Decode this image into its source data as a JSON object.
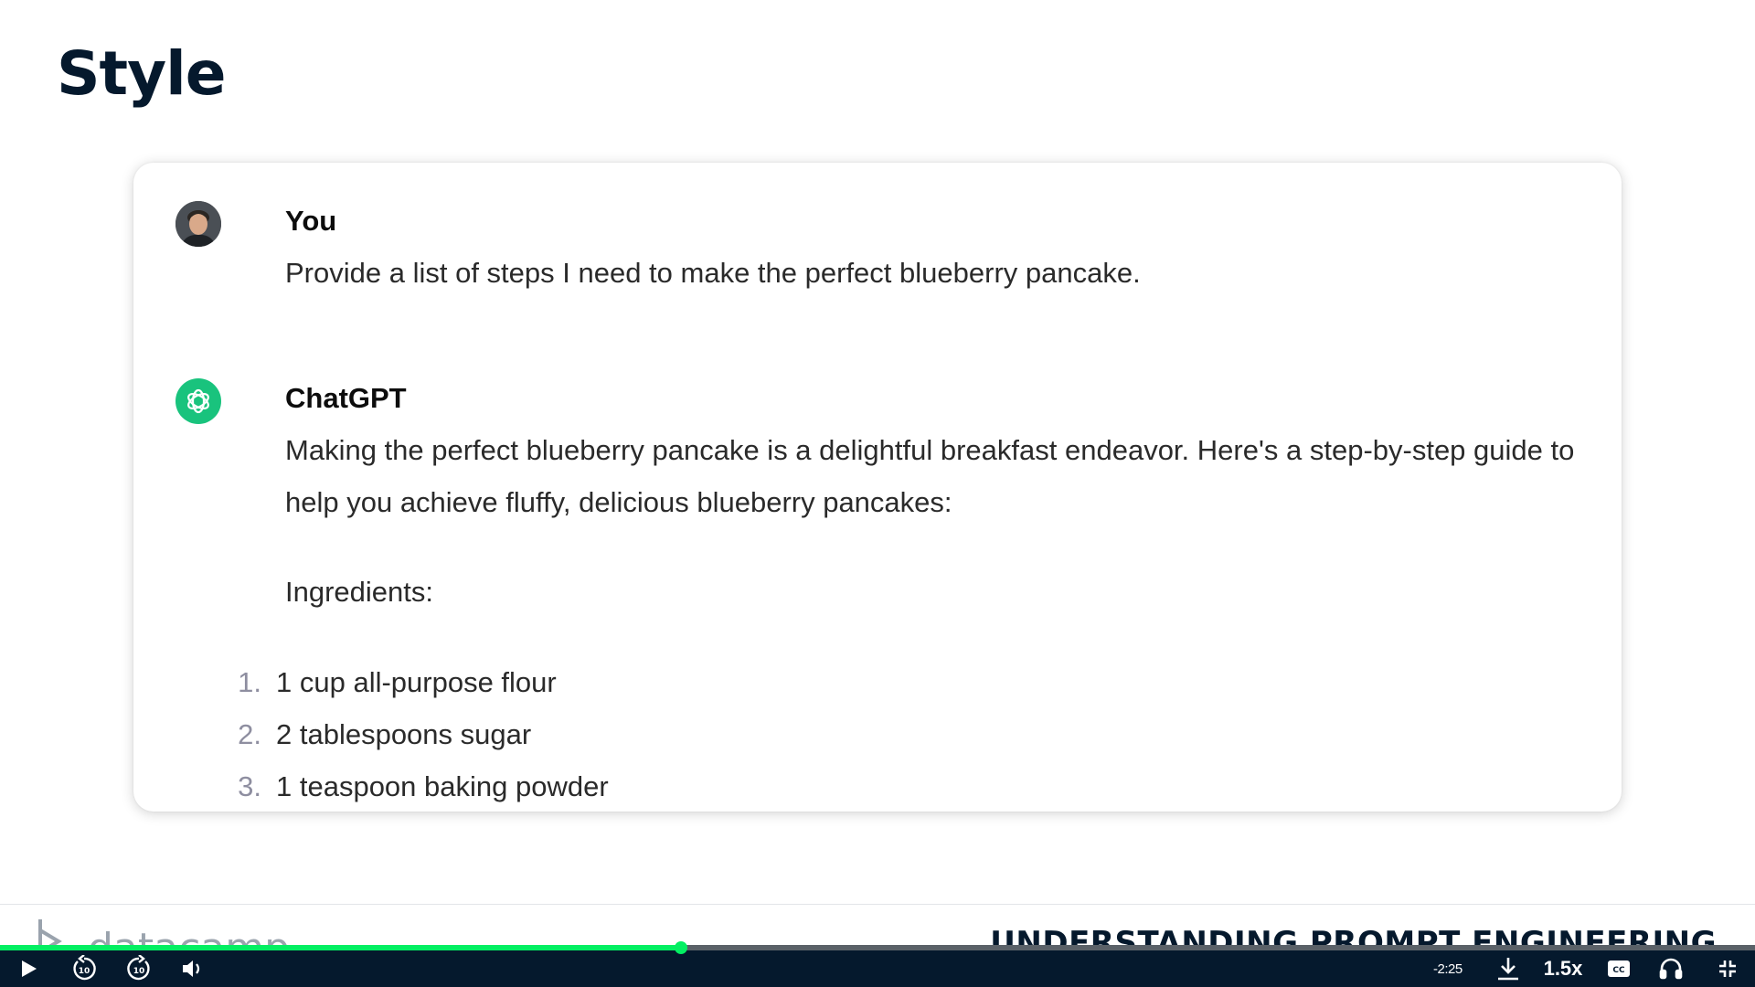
{
  "slide": {
    "title": "Style"
  },
  "chat": {
    "user": {
      "name": "You",
      "message": "Provide a list of steps I need to make the perfect blueberry pancake."
    },
    "assistant": {
      "name": "ChatGPT",
      "intro": "Making the perfect blueberry pancake is a delightful breakfast endeavor. Here's a step-by-step guide to help you achieve fluffy, delicious blueberry pancakes:",
      "ingredients_heading": "Ingredients:",
      "ingredients": [
        {
          "num": "1.",
          "text": "1 cup all-purpose flour"
        },
        {
          "num": "2.",
          "text": "2 tablespoons sugar"
        },
        {
          "num": "3.",
          "text": "1 teaspoon baking powder"
        }
      ]
    }
  },
  "footer": {
    "brand": "datacamp",
    "course_title": "UNDERSTANDING PROMPT ENGINEERING"
  },
  "player": {
    "progress": 0.388,
    "time_remaining": "-2:25",
    "speed": "1.5x",
    "rewind_seconds": "10",
    "forward_seconds": "10",
    "accent_color": "#03ef62",
    "bar_color": "#05192d",
    "icons": [
      "play-icon",
      "rewind-10-icon",
      "forward-10-icon",
      "volume-icon",
      "download-icon",
      "captions-icon",
      "headphones-icon",
      "exit-fullscreen-icon"
    ]
  }
}
